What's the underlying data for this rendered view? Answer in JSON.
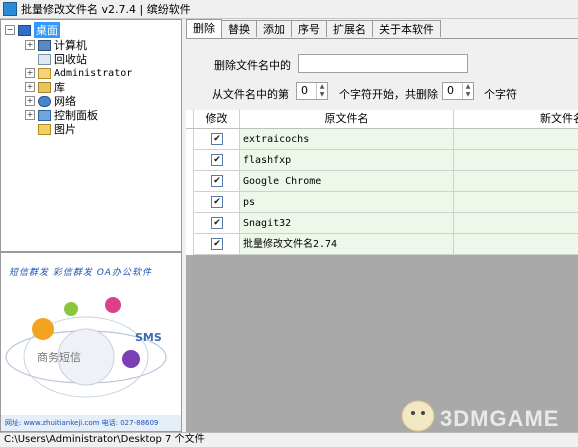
{
  "window": {
    "title": "批量修改文件名 v2.7.4 | 缤纷软件"
  },
  "tree": {
    "items": [
      {
        "label": "桌面",
        "icon": "desktop-icon",
        "expander": "−",
        "selected": true
      },
      {
        "label": "计算机",
        "icon": "computer-icon",
        "expander": "+"
      },
      {
        "label": "回收站",
        "icon": "recycle-bin-icon",
        "expander": ""
      },
      {
        "label": "Administrator",
        "icon": "user-folder-icon",
        "expander": "+"
      },
      {
        "label": "库",
        "icon": "library-icon",
        "expander": "+"
      },
      {
        "label": "网络",
        "icon": "network-icon",
        "expander": "+"
      },
      {
        "label": "控制面板",
        "icon": "control-panel-icon",
        "expander": "+"
      },
      {
        "label": "图片",
        "icon": "folder-icon",
        "expander": ""
      }
    ]
  },
  "ad": {
    "slogan": "短信群发 彩信群发 OA办公软件",
    "center_text": "商务短信",
    "sms_text": "SMS",
    "footer": "网址: www.zhuitiankeji.com 电话: 027-88609"
  },
  "tabs": [
    {
      "label": "删除",
      "active": true
    },
    {
      "label": "替换"
    },
    {
      "label": "添加"
    },
    {
      "label": "序号"
    },
    {
      "label": "扩展名"
    },
    {
      "label": "关于本软件"
    }
  ],
  "delete_panel": {
    "delete_label": "删除文件名中的",
    "delete_value": "",
    "from_label": "从文件名中的第",
    "start_value": "0",
    "mid_label": "个字符开始，共删除",
    "count_value": "0",
    "end_label": "个字符"
  },
  "grid": {
    "columns": [
      "修改",
      "原文件名",
      "新文件名"
    ],
    "rows": [
      {
        "checked": true,
        "name": "extraicochs"
      },
      {
        "checked": true,
        "name": "flashfxp"
      },
      {
        "checked": true,
        "name": "Google Chrome"
      },
      {
        "checked": true,
        "name": "ps"
      },
      {
        "checked": true,
        "name": "Snagit32"
      },
      {
        "checked": true,
        "name": "批量修改文件名2.74"
      }
    ]
  },
  "watermark": "3DMGAME",
  "status": {
    "text": "C:\\Users\\Administrator\\Desktop  7 个文件"
  }
}
